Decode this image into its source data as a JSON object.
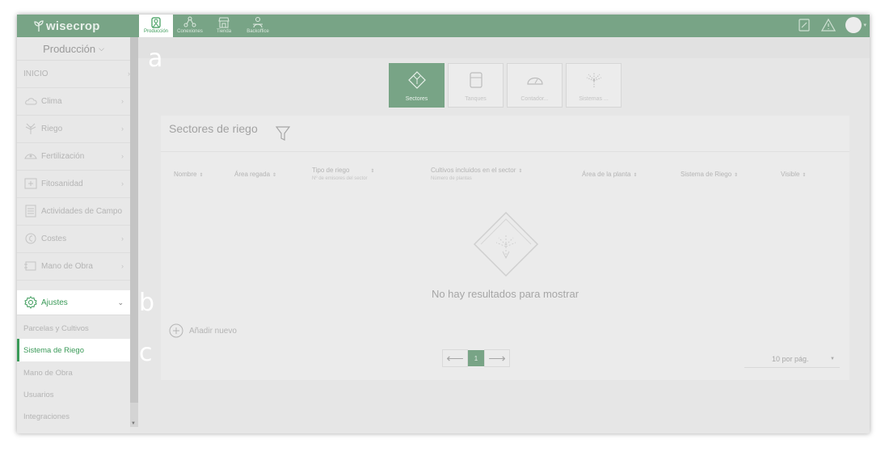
{
  "app": {
    "logo": "wisecrop"
  },
  "topbar": {
    "apps": [
      {
        "label": "Producción",
        "icon": "farm-icon",
        "active": true
      },
      {
        "label": "Conexiones",
        "icon": "connections-icon",
        "active": false
      },
      {
        "label": "Tienda",
        "icon": "store-icon",
        "active": false
      },
      {
        "label": "Backoffice",
        "icon": "backoffice-icon",
        "active": false
      }
    ]
  },
  "sidebar": {
    "module": "Producción",
    "items": [
      {
        "label": "INICIO",
        "icon": null
      },
      {
        "label": "Clima",
        "icon": "cloud-icon"
      },
      {
        "label": "Riego",
        "icon": "irrigation-icon"
      },
      {
        "label": "Fertilización",
        "icon": "fertilizer-icon"
      },
      {
        "label": "Fitosanidad",
        "icon": "first-aid-icon"
      },
      {
        "label": "Actividades de Campo",
        "icon": "activities-icon"
      },
      {
        "label": "Costes",
        "icon": "coins-icon"
      },
      {
        "label": "Mano de Obra",
        "icon": "labor-icon"
      }
    ],
    "settings": {
      "label": "Ajustes",
      "icon": "gear-icon"
    },
    "subitems": [
      {
        "label": "Parcelas y Cultivos",
        "current": false
      },
      {
        "label": "Sistema de Riego",
        "current": true
      },
      {
        "label": "Mano de Obra",
        "current": false
      },
      {
        "label": "Usuarios",
        "current": false
      },
      {
        "label": "Integraciones",
        "current": false
      }
    ]
  },
  "cards": [
    {
      "label": "Sectores",
      "icon": "sectors-icon",
      "active": true
    },
    {
      "label": "Tanques",
      "icon": "tank-icon",
      "active": false
    },
    {
      "label": "Contador...",
      "icon": "meter-icon",
      "active": false
    },
    {
      "label": "Sistemas ...",
      "icon": "sprinkler-icon",
      "active": false
    }
  ],
  "panel": {
    "title": "Sectores de riego",
    "columns": [
      {
        "label": "Nombre",
        "sub": ""
      },
      {
        "label": "Área regada",
        "sub": ""
      },
      {
        "label": "Tipo de riego",
        "sub": "Nº de emisores del sector"
      },
      {
        "label": "Cultivos incluidos en el sector",
        "sub": "Número de plantas"
      },
      {
        "label": "Área de la planta",
        "sub": ""
      },
      {
        "label": "Sistema de Riego",
        "sub": ""
      },
      {
        "label": "Visible",
        "sub": ""
      }
    ],
    "sort_symbol": "⇕",
    "empty_text": "No hay resultados para mostrar",
    "add_new": "Añadir nuevo",
    "pagination": {
      "current_page": "1"
    },
    "per_page": "10 por pág."
  },
  "callouts": {
    "a": "a",
    "b": "b",
    "c": "c"
  },
  "colors": {
    "accent": "#3a9a58",
    "topbar": "#78a486"
  }
}
